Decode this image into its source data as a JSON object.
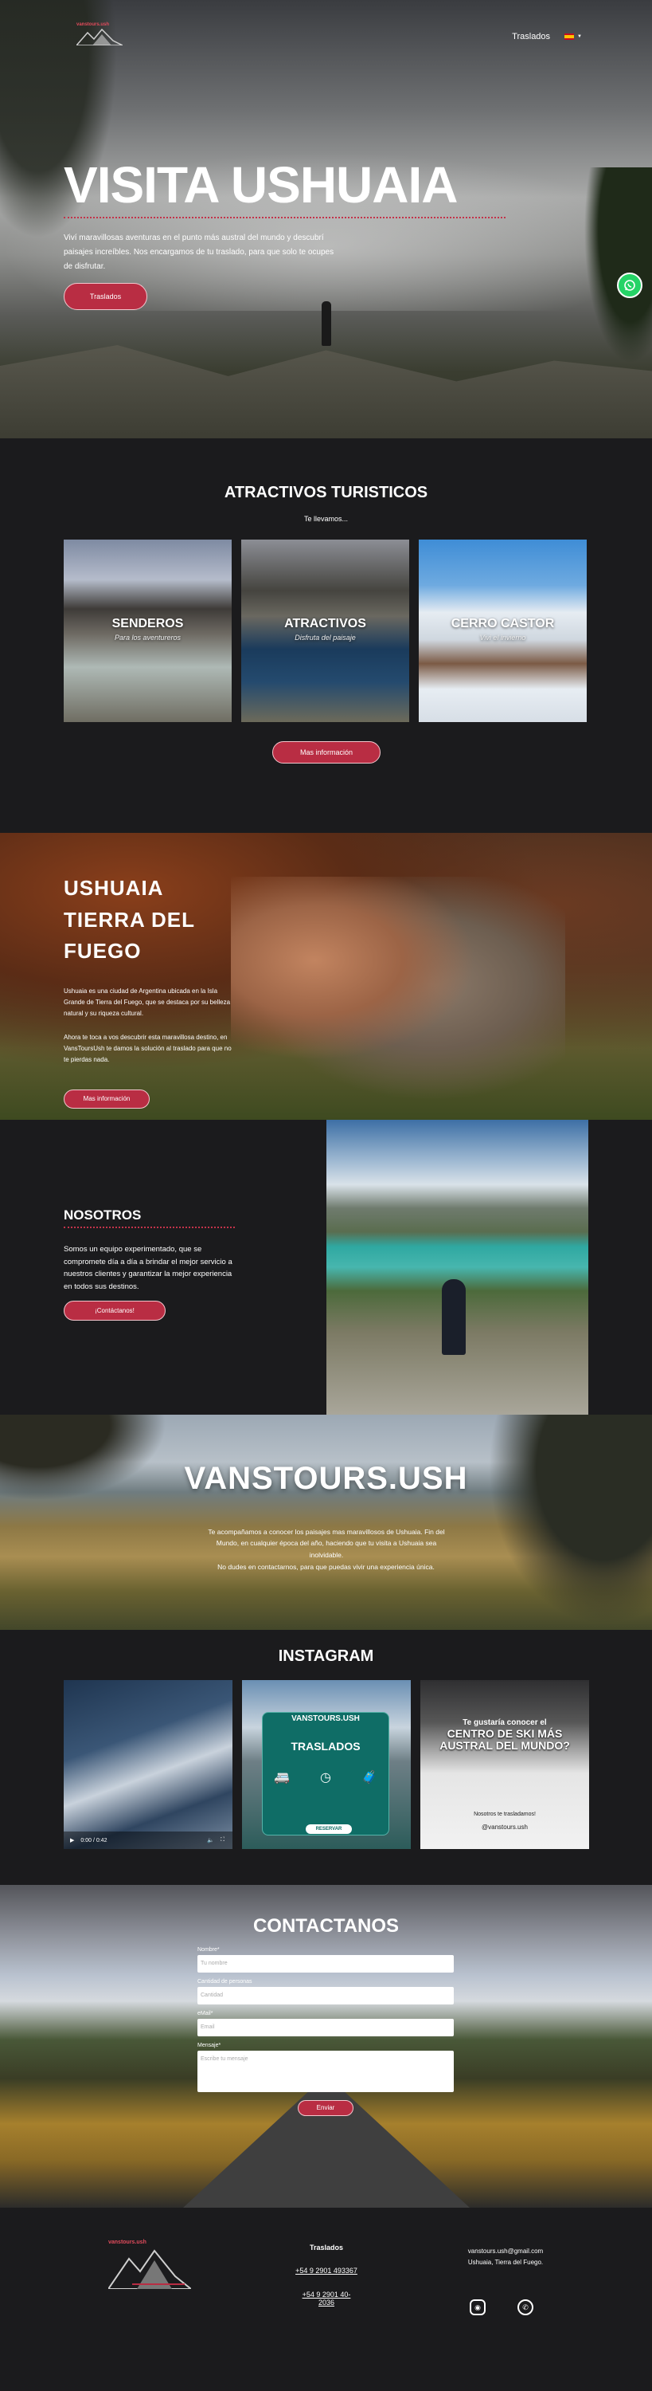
{
  "brand": {
    "logo_text": "vanstours.ush"
  },
  "nav": {
    "items": [
      "Traslados"
    ],
    "language": "es"
  },
  "hero": {
    "title": "VISITA USHUAIA",
    "text": "Viví maravillosas aventuras en el punto más austral del mundo y descubrí paisajes increíbles. Nos encargamos de tu traslado, para que solo te ocupes de disfrutar.",
    "button": "Traslados"
  },
  "attractions": {
    "title": "ATRACTIVOS TURISTICOS",
    "subtitle": "Te llevamos...",
    "cards": [
      {
        "title": "SENDEROS",
        "subtitle": "Para los aventureros"
      },
      {
        "title": "ATRACTIVOS",
        "subtitle": "Disfruta del paisaje"
      },
      {
        "title": "CERRO CASTOR",
        "subtitle": "Vivi el invierno"
      }
    ],
    "button": "Mas información"
  },
  "ushuaia": {
    "line1": "USHUAIA",
    "line2": "TIERRA DEL",
    "line3": "FUEGO",
    "p1": "Ushuaia es una ciudad de Argentina ubicada en la Isla Grande de Tierra del Fuego, que se destaca por su belleza natural y su riqueza cultural.",
    "p2": "Ahora te toca a vos descubrir esta maravillosa destino, en VansToursUsh te damos la solución al traslado para que no te pierdas nada.",
    "button": "Mas información"
  },
  "about": {
    "title": "NOSOTROS",
    "text": "Somos un equipo experimentado, que se compromete día a día a brindar el mejor servicio a nuestros clientes y garantizar la mejor experiencia en todos sus destinos.",
    "button": "¡Contáctanos!"
  },
  "vans": {
    "title": "VANSTOURS.USH",
    "p1": "Te acompañamos a conocer los paisajes mas maravillosos de Ushuaia. Fin del Mundo, en cualquier época del año, haciendo que tu visita a Ushuaia sea inolvidable.",
    "p2": "No dudes en contactarnos, para que puedas vivir una experiencia única."
  },
  "instagram": {
    "title": "INSTAGRAM",
    "video_time": "0:00 / 0:42",
    "post2": {
      "brand": "VANSTOURS.USH",
      "title": "TRASLADOS",
      "button": "RESERVAR"
    },
    "post3": {
      "line1": "Te gustaría conocer el",
      "line2": "CENTRO DE SKI MÁS AUSTRAL DEL MUNDO?",
      "line3": "Nosotros te trasladamos!",
      "handle": "@vanstours.ush"
    }
  },
  "contact": {
    "title": "CONTACTANOS",
    "fields": [
      {
        "label": "Nombre*",
        "placeholder": "Tu nombre"
      },
      {
        "label": "Cantidad de personas",
        "placeholder": "Cantidad"
      },
      {
        "label": "eMail*",
        "placeholder": "Email"
      },
      {
        "label": "Mensaje*",
        "placeholder": "Escribe tu mensaje"
      }
    ],
    "button": "Enviar"
  },
  "footer": {
    "nav_title": "Traslados",
    "phone1": "+54 9 2901 493367",
    "phone2": "+54 9 2901 40-2036",
    "email": "vanstours.ush@gmail.com",
    "location": "Ushuaia, Tierra del Fuego."
  },
  "icons": [
    "whatsapp-icon",
    "instagram-icon",
    "play-icon",
    "volume-icon",
    "fullscreen-icon",
    "van-icon",
    "clock-icon",
    "luggage-icon"
  ],
  "colors": {
    "accent": "#b92d43",
    "dark_bg": "#1b1b1d",
    "whatsapp": "#25d366"
  }
}
